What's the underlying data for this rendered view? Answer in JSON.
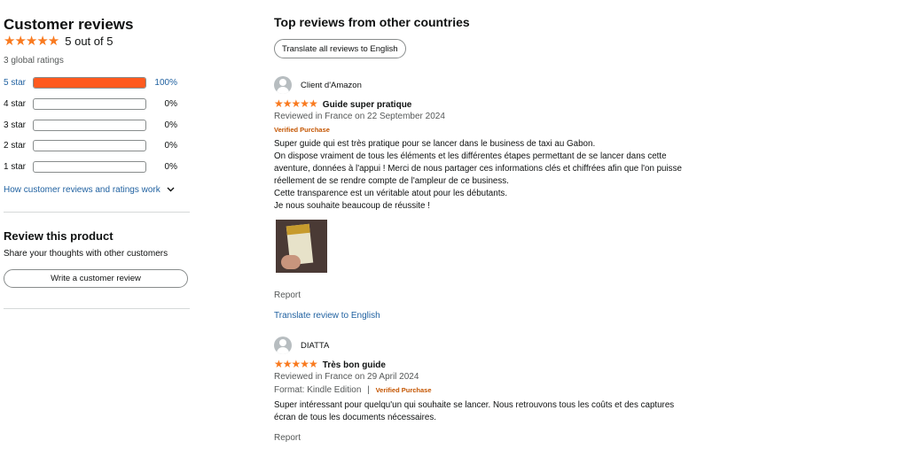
{
  "summary": {
    "title": "Customer reviews",
    "stars": "★★★★★",
    "average": "5 out of 5",
    "global_ratings": "3 global ratings",
    "histogram": [
      {
        "label": "5 star",
        "percent_text": "100%",
        "fraction": 1.0
      },
      {
        "label": "4 star",
        "percent_text": "0%",
        "fraction": 0
      },
      {
        "label": "3 star",
        "percent_text": "0%",
        "fraction": 0
      },
      {
        "label": "2 star",
        "percent_text": "0%",
        "fraction": 0
      },
      {
        "label": "1 star",
        "percent_text": "0%",
        "fraction": 0
      }
    ],
    "how_link": "How customer reviews and ratings work",
    "chevron_icon": "chevron-down-icon"
  },
  "review_product": {
    "title": "Review this product",
    "subtitle": "Share your thoughts with other customers",
    "button": "Write a customer review"
  },
  "reviews_section": {
    "title": "Top reviews from other countries",
    "translate_all": "Translate all reviews to English",
    "reviews": [
      {
        "name": "Client d'Amazon",
        "stars": "★★★★★",
        "headline": "Guide super pratique",
        "date": "Reviewed in France on 22 September 2024",
        "verified": "Verified Purchase",
        "body": [
          "Super guide qui est très pratique pour se lancer dans le business de taxi au Gabon.",
          "On dispose vraiment de tous les éléments et les différentes étapes permettant de se lancer dans cette",
          "aventure, données à l'appui ! Merci de nous partager ces informations clés et chiffrées afin que l'on puisse",
          "réellement de se rendre compte de l'ampleur de ce business.",
          "Cette transparence est un véritable atout pour les débutants.",
          "Je nous souhaite beaucoup de réussite !"
        ],
        "report": "Report",
        "translate": "Translate review to English"
      },
      {
        "name": "DIATTA",
        "stars": "★★★★★",
        "headline": "Très bon guide",
        "date": "Reviewed in France on 29 April 2024",
        "format": "Format: Kindle Edition",
        "separator": "|",
        "verified": "Verified Purchase",
        "body": [
          "Super intéressant pour quelqu'un qui souhaite se lancer. Nous retrouvons tous les coûts et des captures",
          "écran de tous les documents nécessaires."
        ],
        "report": "Report"
      }
    ]
  }
}
